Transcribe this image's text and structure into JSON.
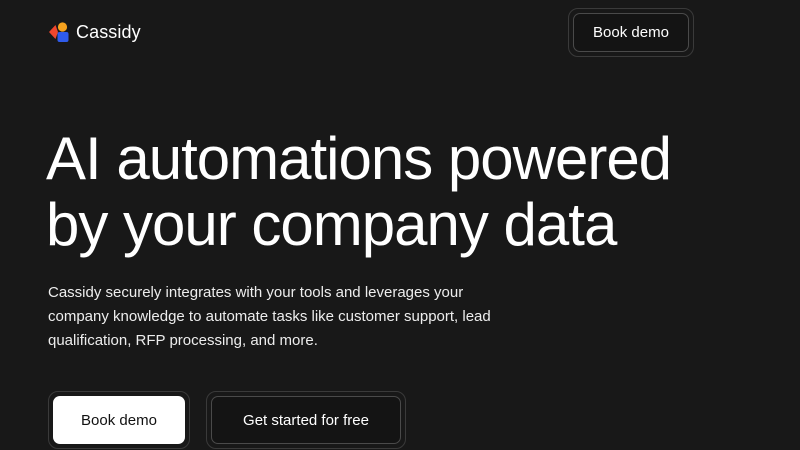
{
  "brand": {
    "name": "Cassidy",
    "logo_icon": "cassidy-logo-icon",
    "logo_colors": {
      "red": "#f0462d",
      "orange": "#f6a21e",
      "blue": "#2f5bea"
    }
  },
  "header": {
    "cta_label": "Book demo"
  },
  "hero": {
    "title_line1": "AI automations powered",
    "title_line2": "by your company data",
    "subtitle": "Cassidy securely integrates with your tools and leverages your company knowledge to automate tasks like customer support, lead qualification, RFP processing, and more."
  },
  "cta": {
    "primary_label": "Book demo",
    "secondary_label": "Get started for free"
  },
  "theme": {
    "background": "#181818",
    "text": "#ffffff",
    "button_light": "#ffffff",
    "button_dark": "#141414"
  }
}
